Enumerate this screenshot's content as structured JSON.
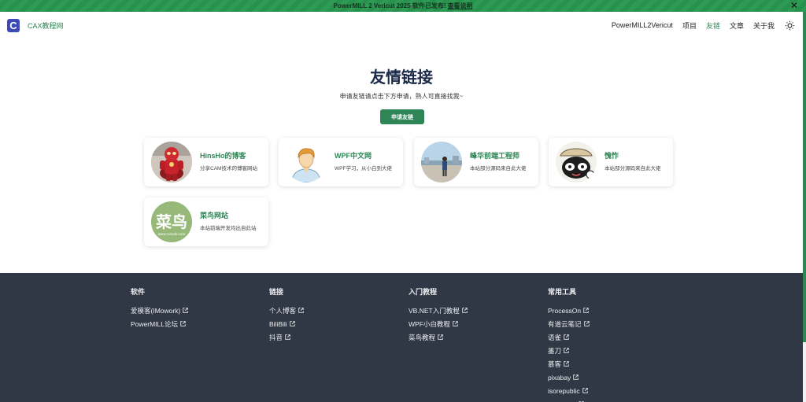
{
  "announcement": {
    "text": "PowerMILL 2 Vericut 2025 软件已发布! ",
    "link_label": "查看说明",
    "close_glyph": "✕"
  },
  "navbar": {
    "logo_letter": "C",
    "brand": "CAX教程网",
    "items": [
      "PowerMILL2Vericut",
      "项目",
      "友链",
      "文章",
      "关于我"
    ],
    "active_item": "友链",
    "theme_icon": "sun-icon"
  },
  "hero": {
    "title": "友情链接",
    "subtitle": "申请友链请点击下方申请，熟人可直接找我~",
    "button_label": "申请友链"
  },
  "cards": [
    {
      "name": "HinsHo的博客",
      "desc": "分享CAM技术的博客网站",
      "avatar": "robot-figure-avatar"
    },
    {
      "name": "WPF中文网",
      "desc": "WPF学习，从小白到大佬",
      "avatar": "person-avatar"
    },
    {
      "name": "峰华前端工程师",
      "desc": "本站部分源码来自此大佬",
      "avatar": "photo-person-avatar"
    },
    {
      "name": "愧怍",
      "desc": "本站部分源码来自此大佬",
      "avatar": "cartoon-avatar"
    },
    {
      "name": "菜鸟网站",
      "desc": "本站前端开发均出自此站",
      "avatar": "runoob-avatar",
      "avatar_text": "菜鸟",
      "avatar_url_text": "www.runoob.com"
    }
  ],
  "footer": {
    "columns": [
      {
        "title": "软件",
        "links": [
          "爱模客(IMowork)",
          "PowerMILL论坛"
        ]
      },
      {
        "title": "链接",
        "links": [
          "个人博客",
          "BiliBili",
          "抖音"
        ]
      },
      {
        "title": "入门教程",
        "links": [
          "VB.NET入门教程",
          "WPF小白教程",
          "菜鸟教程"
        ]
      },
      {
        "title": "常用工具",
        "links": [
          "ProcessOn",
          "有道云笔记",
          "语雀",
          "墨刀",
          "慕客",
          "pixabay",
          "isorepublic",
          "librestock"
        ]
      }
    ]
  },
  "colors": {
    "accent": "#2e8555",
    "footer_bg": "#303846",
    "title": "#1b2a49",
    "announcement_bg": "#2e9a54"
  }
}
